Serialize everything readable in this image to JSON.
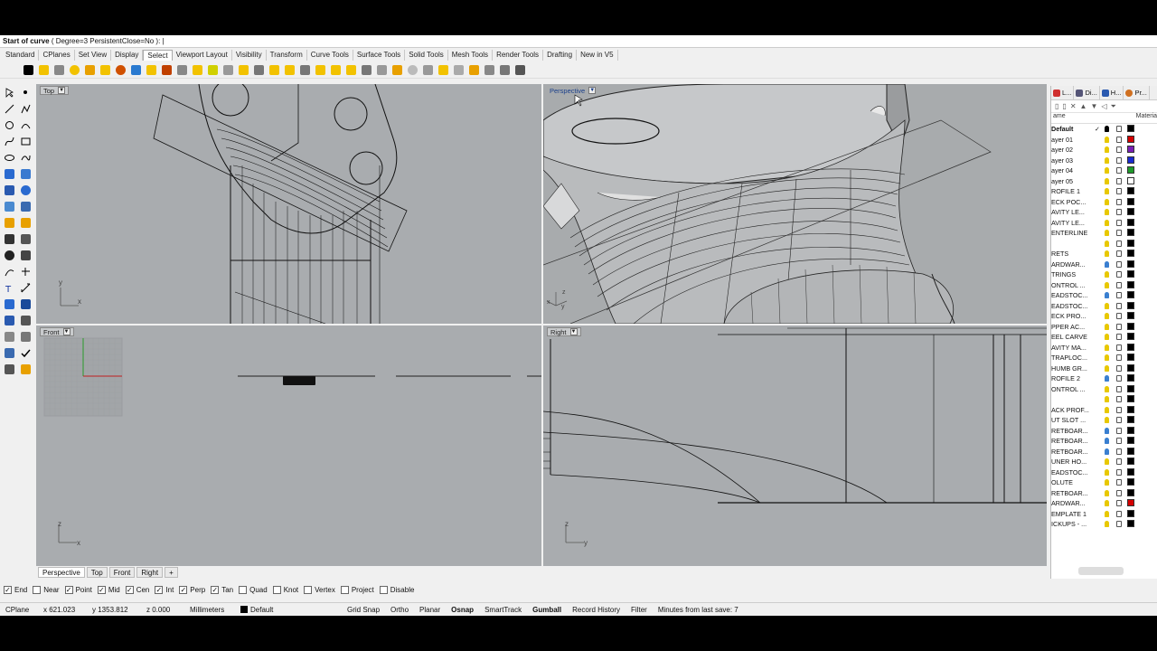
{
  "command": {
    "prefix": "Start of curve",
    "options": "( Degree=3  PersistentClose=No ):"
  },
  "tabs": [
    "Standard",
    "CPlanes",
    "Set View",
    "Display",
    "Select",
    "Viewport Layout",
    "Visibility",
    "Transform",
    "Curve Tools",
    "Surface Tools",
    "Solid Tools",
    "Mesh Tools",
    "Render Tools",
    "Drafting",
    "New in V5"
  ],
  "active_tab": "Select",
  "viewports": {
    "top": {
      "label": "Top",
      "axis_a": "y",
      "axis_b": "x"
    },
    "perspective": {
      "label": "Perspective",
      "axis_a": "z",
      "axis_b": "y",
      "axis_c": "x"
    },
    "front": {
      "label": "Front",
      "axis_a": "z",
      "axis_b": "x"
    },
    "right": {
      "label": "Right",
      "axis_a": "z",
      "axis_b": "y"
    }
  },
  "viewport_tabs": [
    "Perspective",
    "Top",
    "Front",
    "Right"
  ],
  "viewport_add": "+",
  "osnaps": [
    {
      "label": "End",
      "checked": true
    },
    {
      "label": "Near",
      "checked": false
    },
    {
      "label": "Point",
      "checked": true
    },
    {
      "label": "Mid",
      "checked": true
    },
    {
      "label": "Cen",
      "checked": true
    },
    {
      "label": "Int",
      "checked": true
    },
    {
      "label": "Perp",
      "checked": true
    },
    {
      "label": "Tan",
      "checked": true
    },
    {
      "label": "Quad",
      "checked": false
    },
    {
      "label": "Knot",
      "checked": false
    },
    {
      "label": "Vertex",
      "checked": false
    },
    {
      "label": "Project",
      "checked": false
    },
    {
      "label": "Disable",
      "checked": false
    }
  ],
  "status": {
    "cplane": "CPlane",
    "x": "x 621.023",
    "y": "y 1353.812",
    "z": "z 0.000",
    "units": "Millimeters",
    "layer": "Default",
    "grid_snap": "Grid Snap",
    "ortho": "Ortho",
    "planar": "Planar",
    "osnap": "Osnap",
    "smarttrack": "SmartTrack",
    "gumball": "Gumball",
    "record": "Record History",
    "filter": "Filter",
    "save": "Minutes from last save: 7"
  },
  "panel": {
    "tabs": [
      "L...",
      "Di...",
      "H...",
      "Pr..."
    ],
    "col_name": "ame",
    "col_material": "Materia",
    "layers": [
      {
        "name": "Default",
        "check": "✓",
        "bulb": "#000",
        "color": "#000",
        "bold": true
      },
      {
        "name": "ayer 01",
        "check": "",
        "bulb": "#e8c800",
        "color": "#d40000"
      },
      {
        "name": "ayer 02",
        "check": "",
        "bulb": "#e8c800",
        "color": "#7a1fb4"
      },
      {
        "name": "ayer 03",
        "check": "",
        "bulb": "#e8c800",
        "color": "#1a2ad0"
      },
      {
        "name": "ayer 04",
        "check": "",
        "bulb": "#e8c800",
        "color": "#1f9a2a"
      },
      {
        "name": "ayer 05",
        "check": "",
        "bulb": "#e8c800",
        "color": "#ffffff"
      },
      {
        "name": "ROFILE 1",
        "check": "",
        "bulb": "#e8c800",
        "color": "#000"
      },
      {
        "name": "ECK POC...",
        "check": "",
        "bulb": "#e8c800",
        "color": "#000"
      },
      {
        "name": "AVITY LE...",
        "check": "",
        "bulb": "#e8c800",
        "color": "#000"
      },
      {
        "name": "AVITY LE...",
        "check": "",
        "bulb": "#e8c800",
        "color": "#000"
      },
      {
        "name": "ENTERLINE",
        "check": "",
        "bulb": "#e8c800",
        "color": "#000"
      },
      {
        "name": "",
        "check": "",
        "bulb": "#e8c800",
        "color": "#000"
      },
      {
        "name": "RETS",
        "check": "",
        "bulb": "#e8c800",
        "color": "#000"
      },
      {
        "name": "ARDWAR...",
        "check": "",
        "bulb": "#3a7fd0",
        "color": "#000"
      },
      {
        "name": "TRINGS",
        "check": "",
        "bulb": "#e8c800",
        "color": "#000"
      },
      {
        "name": "ONTROL ...",
        "check": "",
        "bulb": "#e8c800",
        "color": "#000"
      },
      {
        "name": "EADSTOC...",
        "check": "",
        "bulb": "#3a7fd0",
        "color": "#000"
      },
      {
        "name": "EADSTOC...",
        "check": "",
        "bulb": "#e8c800",
        "color": "#000"
      },
      {
        "name": "ECK PRO...",
        "check": "",
        "bulb": "#e8c800",
        "color": "#000"
      },
      {
        "name": "PPER AC...",
        "check": "",
        "bulb": "#e8c800",
        "color": "#000"
      },
      {
        "name": "EEL CARVE",
        "check": "",
        "bulb": "#e8c800",
        "color": "#000"
      },
      {
        "name": "AVITY MA...",
        "check": "",
        "bulb": "#e8c800",
        "color": "#000"
      },
      {
        "name": "TRAPLOC...",
        "check": "",
        "bulb": "#e8c800",
        "color": "#000"
      },
      {
        "name": "HUMB GR...",
        "check": "",
        "bulb": "#e8c800",
        "color": "#000"
      },
      {
        "name": "ROFILE 2",
        "check": "",
        "bulb": "#3a7fd0",
        "color": "#000"
      },
      {
        "name": "ONTROL ...",
        "check": "",
        "bulb": "#e8c800",
        "color": "#000"
      },
      {
        "name": "",
        "check": "",
        "bulb": "#e8c800",
        "color": "#000"
      },
      {
        "name": "ACK PROF...",
        "check": "",
        "bulb": "#e8c800",
        "color": "#000"
      },
      {
        "name": "UT SLOT ...",
        "check": "",
        "bulb": "#e8c800",
        "color": "#000"
      },
      {
        "name": "RETBOAR...",
        "check": "",
        "bulb": "#3a7fd0",
        "color": "#000"
      },
      {
        "name": "RETBOAR...",
        "check": "",
        "bulb": "#3a7fd0",
        "color": "#000"
      },
      {
        "name": "RETBOAR...",
        "check": "",
        "bulb": "#3a7fd0",
        "color": "#000"
      },
      {
        "name": "UNER HO...",
        "check": "",
        "bulb": "#e8c800",
        "color": "#000"
      },
      {
        "name": "EADSTOC...",
        "check": "",
        "bulb": "#e8c800",
        "color": "#000"
      },
      {
        "name": "OLUTE",
        "check": "",
        "bulb": "#e8c800",
        "color": "#000"
      },
      {
        "name": "RETBOAR...",
        "check": "",
        "bulb": "#e8c800",
        "color": "#000"
      },
      {
        "name": "ARDWAR...",
        "check": "",
        "bulb": "#e8c800",
        "color": "#d40000"
      },
      {
        "name": "EMPLATE 1",
        "check": "",
        "bulb": "#e8c800",
        "color": "#000"
      },
      {
        "name": "ICKUPS - ...",
        "check": "",
        "bulb": "#e8c800",
        "color": "#000"
      }
    ]
  }
}
